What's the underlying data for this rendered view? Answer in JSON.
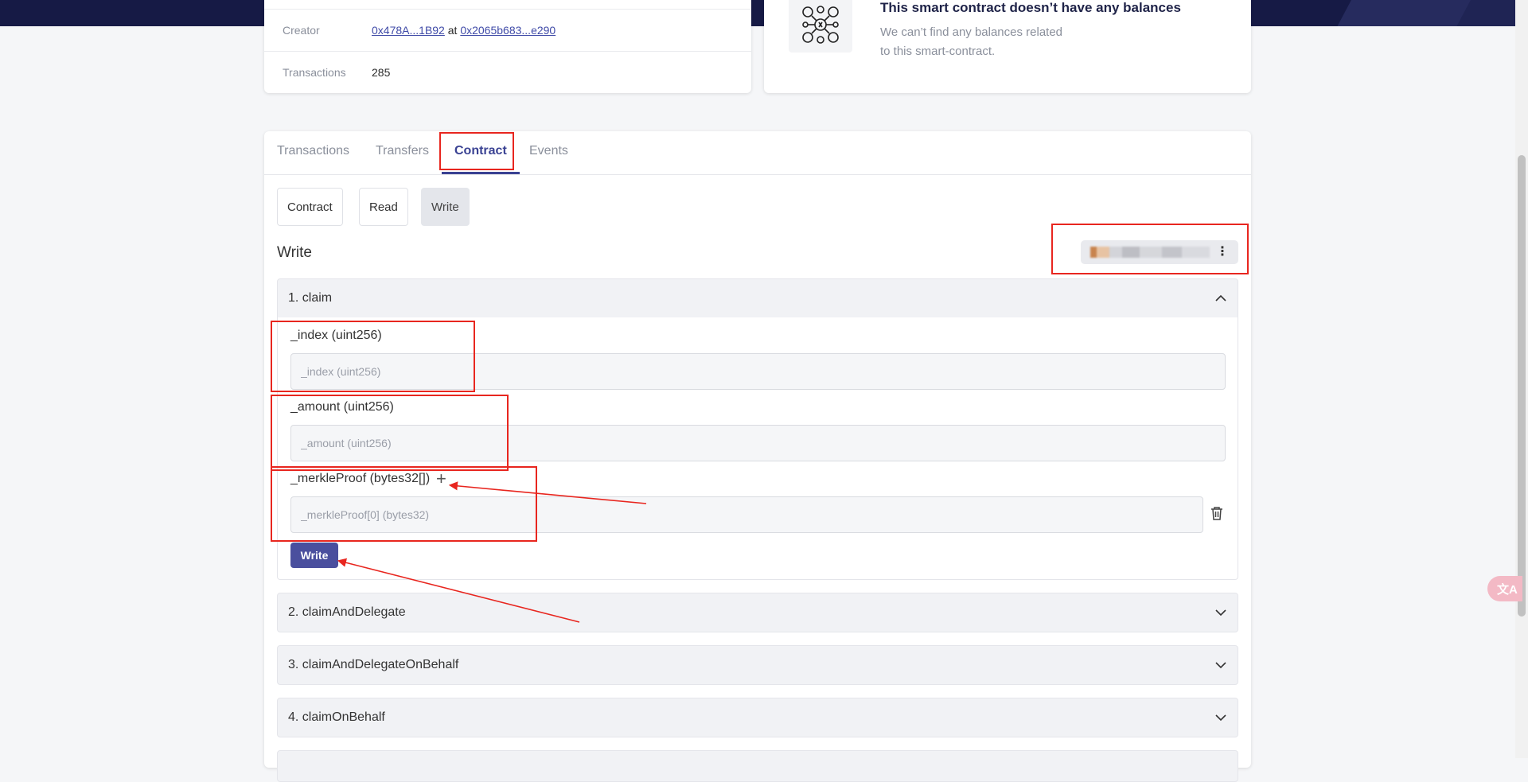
{
  "info": {
    "creator_label": "Creator",
    "creator_address": "0x478A...1B92",
    "creator_at": "at",
    "creator_tx": "0x2065b683...e290",
    "transactions_label": "Transactions",
    "transactions_value": "285"
  },
  "balances": {
    "title": "This smart contract doesn’t have any balances",
    "line1": "We can’t find any balances related",
    "line2": "to this smart-contract."
  },
  "tabs": [
    {
      "label": "Transactions"
    },
    {
      "label": "Transfers"
    },
    {
      "label": "Contract"
    },
    {
      "label": "Events"
    }
  ],
  "subtabs": [
    {
      "label": "Contract"
    },
    {
      "label": "Read"
    },
    {
      "label": "Write"
    }
  ],
  "write": {
    "heading": "Write",
    "wallet_menu_icon": "more-vertical-icon"
  },
  "functions": [
    {
      "title": "1. claim"
    },
    {
      "title": "2. claimAndDelegate"
    },
    {
      "title": "3. claimAndDelegateOnBehalf"
    },
    {
      "title": "4. claimOnBehalf"
    }
  ],
  "claim_form": {
    "index_label": "_index (uint256)",
    "index_placeholder": "_index (uint256)",
    "amount_label": "_amount (uint256)",
    "amount_placeholder": "_amount (uint256)",
    "proof_label": "_merkleProof (bytes32[])",
    "proof_add": "+",
    "proof_placeholder": "_merkleProof[0] (bytes32)",
    "submit_label": "Write"
  },
  "translate": {
    "label": "文A"
  },
  "colors": {
    "accent": "#3a4293",
    "button": "#4a4f9e",
    "annotation": "#e8261f",
    "header": "#161a45"
  }
}
